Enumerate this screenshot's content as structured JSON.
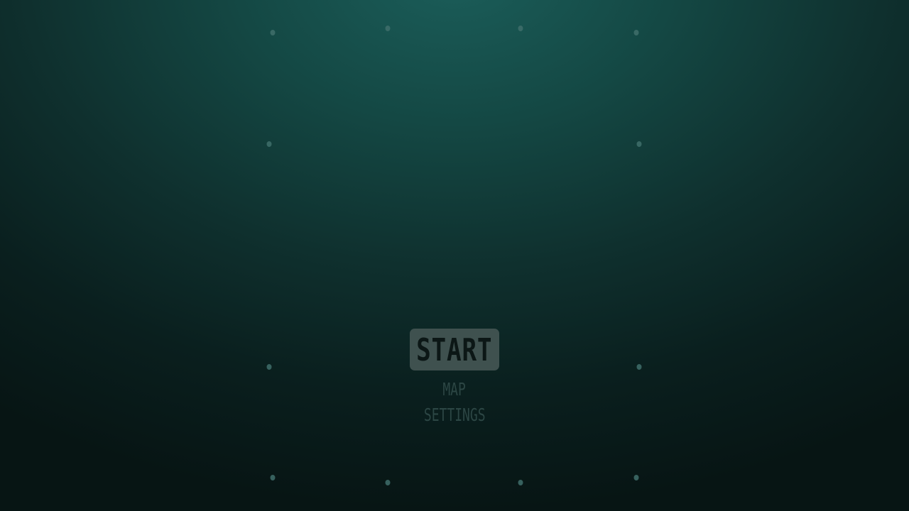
{
  "menu": {
    "start_label": "START",
    "map_label": "MAP",
    "settings_label": "SETTINGS"
  },
  "colors": {
    "background_top": "#1b5e5a",
    "background_bottom": "#071514",
    "start_button_bg": "#3f514f",
    "menu_text": "#2c4644",
    "dot": "#3f6f6b"
  }
}
